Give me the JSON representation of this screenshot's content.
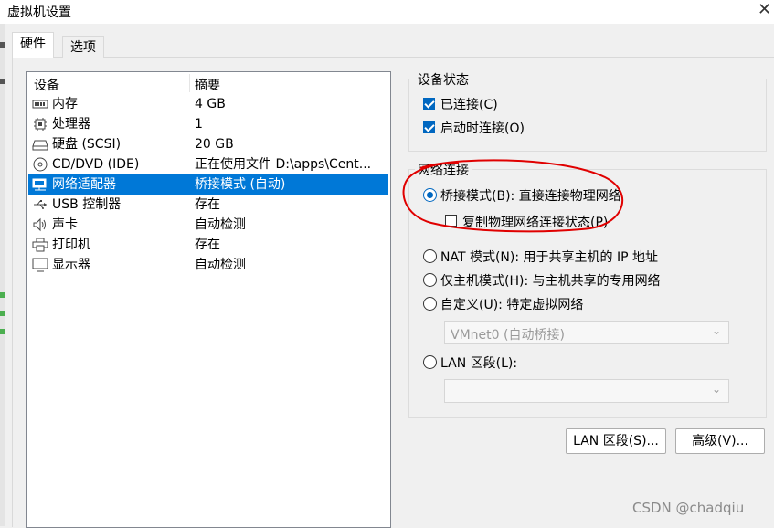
{
  "window": {
    "title": "虚拟机设置",
    "close_glyph": "✕"
  },
  "tabs": [
    {
      "label": "硬件"
    },
    {
      "label": "选项"
    }
  ],
  "device_list": {
    "columns": {
      "device": "设备",
      "summary": "摘要"
    },
    "rows": [
      {
        "name": "内存",
        "summary": "4 GB",
        "icon": "memory-icon"
      },
      {
        "name": "处理器",
        "summary": "1",
        "icon": "processor-icon"
      },
      {
        "name": "硬盘 (SCSI)",
        "summary": "20 GB",
        "icon": "hard-disk-icon"
      },
      {
        "name": "CD/DVD (IDE)",
        "summary": "正在使用文件 D:\\apps\\Cent...",
        "icon": "cd-dvd-icon"
      },
      {
        "name": "网络适配器",
        "summary": "桥接模式 (自动)",
        "icon": "network-adapter-icon",
        "selected": true
      },
      {
        "name": "USB 控制器",
        "summary": "存在",
        "icon": "usb-icon"
      },
      {
        "name": "声卡",
        "summary": "自动检测",
        "icon": "speaker-icon"
      },
      {
        "name": "打印机",
        "summary": "存在",
        "icon": "printer-icon"
      },
      {
        "name": "显示器",
        "summary": "自动检测",
        "icon": "monitor-icon"
      }
    ]
  },
  "device_status": {
    "title": "设备状态",
    "connected": {
      "label": "已连接(C)",
      "checked": true
    },
    "connect_at_power_on": {
      "label": "启动时连接(O)",
      "checked": true
    }
  },
  "network_connection": {
    "title": "网络连接",
    "bridged": {
      "label": "桥接模式(B): 直接连接物理网络",
      "selected": true
    },
    "replicate": {
      "label": "复制物理网络连接状态(P)",
      "checked": false
    },
    "nat": {
      "label": "NAT 模式(N): 用于共享主机的 IP 地址",
      "selected": false
    },
    "host_only": {
      "label": "仅主机模式(H): 与主机共享的专用网络",
      "selected": false
    },
    "custom": {
      "label": "自定义(U): 特定虚拟网络",
      "selected": false
    },
    "custom_select_value": "VMnet0 (自动桥接)",
    "lan_segment": {
      "label": "LAN 区段(L):",
      "selected": false
    },
    "lan_select_value": ""
  },
  "buttons": {
    "lan_segments": "LAN 区段(S)...",
    "advanced": "高级(V)..."
  },
  "watermark": "CSDN @chadqiu",
  "colors": {
    "selection": "#0078d7",
    "annotation": "#e00000",
    "accent": "#0067c0"
  }
}
